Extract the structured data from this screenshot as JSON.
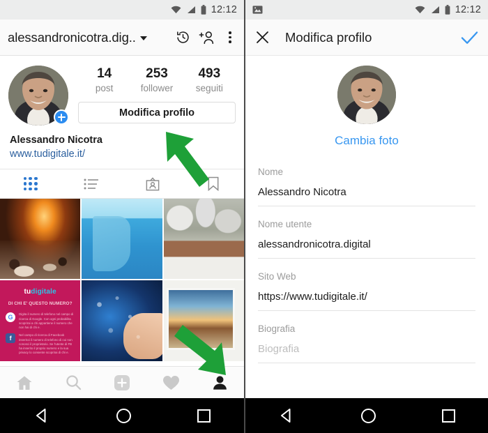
{
  "left": {
    "statusbar": {
      "time": "12:12",
      "icons": [
        "wifi-icon",
        "signal-icon",
        "battery-icon"
      ]
    },
    "appbar": {
      "title": "alessandronicotra.dig..",
      "dropdown_icon": "chevron-down-icon",
      "history_icon": "history-clock-icon",
      "add_person_icon": "add-person-icon",
      "overflow_icon": "more-vertical-icon"
    },
    "profile": {
      "avatar_badge": "+",
      "stats": [
        {
          "num": "14",
          "label": "post"
        },
        {
          "num": "253",
          "label": "follower"
        },
        {
          "num": "493",
          "label": "seguiti"
        }
      ],
      "edit_button": "Modifica profilo",
      "name": "Alessandro Nicotra",
      "website": "www.tudigitale.it/"
    },
    "tabs": [
      {
        "name": "grid-tab",
        "icon": "grid-icon",
        "active": true
      },
      {
        "name": "list-tab",
        "icon": "list-icon",
        "active": false
      },
      {
        "name": "tagged-tab",
        "icon": "person-card-icon",
        "active": false
      },
      {
        "name": "saved-tab",
        "icon": "bookmark-icon",
        "active": false
      }
    ],
    "grid": [
      {
        "alt": "fireplace-with-table-setting",
        "style": "art-fire"
      },
      {
        "alt": "iceberg-underwater",
        "style": "art-ice"
      },
      {
        "alt": "snow-covered-plants",
        "style": "art-snow"
      },
      {
        "alt": "tudigitale-info-card",
        "style": "art-card"
      },
      {
        "alt": "hand-touching-app-icons",
        "style": "art-tech"
      },
      {
        "alt": "framed-landscape-picture",
        "style": "art-paint"
      }
    ],
    "grid_card": {
      "logo_1": "tu",
      "logo_2": "digitale",
      "question": "DI CHI E' QUESTO NUMERO?",
      "rows": [
        {
          "badge": "G",
          "text": "Digita il numero di telefono nel campo di ricerca di Google. Con ogni probabilita scoprirai a chi appartiene il numero che non hai di chi e."
        },
        {
          "badge": "f",
          "text": "Nel campo di ricerca di Facebook inserisci il numero di telefono di cui non conosci il proprietario. Se l'utente di FB ha inserito il proprio numero e la sua privacy lo consente scoprirai di chi e."
        }
      ]
    },
    "bottomnav": [
      {
        "name": "home-nav",
        "icon": "home-icon",
        "active": false
      },
      {
        "name": "search-nav",
        "icon": "search-icon",
        "active": false
      },
      {
        "name": "add-nav",
        "icon": "plus-square-icon",
        "active": false
      },
      {
        "name": "activity-nav",
        "icon": "heart-icon",
        "active": false
      },
      {
        "name": "profile-nav",
        "icon": "person-icon",
        "active": true
      }
    ],
    "sysnav": [
      {
        "name": "system-back-button",
        "icon": "triangle-back-icon"
      },
      {
        "name": "system-home-button",
        "icon": "circle-home-icon"
      },
      {
        "name": "system-recents-button",
        "icon": "square-recents-icon"
      }
    ]
  },
  "right": {
    "statusbar": {
      "time": "12:12",
      "notification_icon": "screenshot-image-icon",
      "icons": [
        "wifi-icon",
        "signal-icon",
        "battery-icon"
      ]
    },
    "appbar": {
      "close_icon": "close-x-icon",
      "title": "Modifica profilo",
      "confirm_icon": "checkmark-icon"
    },
    "photo": {
      "change_label": "Cambia foto"
    },
    "fields": [
      {
        "label": "Nome",
        "value": "Alessandro Nicotra",
        "placeholder": false
      },
      {
        "label": "Nome utente",
        "value": "alessandronicotra.digital",
        "placeholder": false
      },
      {
        "label": "Sito Web",
        "value": "https://www.tudigitale.it/",
        "placeholder": false
      },
      {
        "label": "Biografia",
        "value": "Biografia",
        "placeholder": true
      }
    ],
    "sysnav": [
      {
        "name": "system-back-button",
        "icon": "triangle-back-icon"
      },
      {
        "name": "system-home-button",
        "icon": "circle-home-icon"
      },
      {
        "name": "system-recents-button",
        "icon": "square-recents-icon"
      }
    ]
  },
  "annotations": {
    "arrow_color": "#1ea038",
    "arrow_up": {
      "target": "Modifica profilo button"
    },
    "arrow_down": {
      "target": "profile tab in bottom navigation"
    }
  },
  "colors": {
    "accent_blue": "#3897f0",
    "link_blue": "#2b5f9e",
    "tab_active_blue": "#2b77cf",
    "arrow_green": "#1ea038",
    "statusbar_bg": "#eceded",
    "appbar_bg": "#fafafa"
  }
}
